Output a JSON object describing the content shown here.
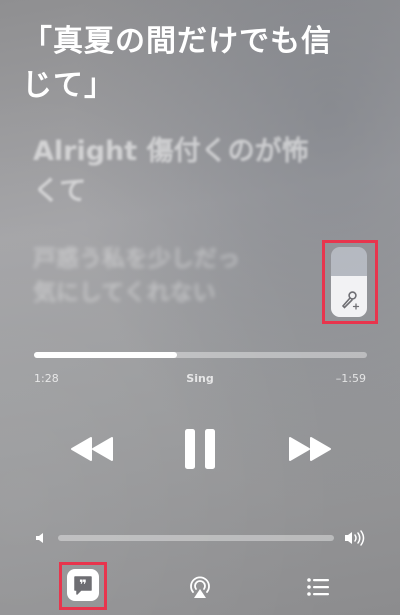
{
  "lyrics": {
    "current_line1": "「真夏の間だけでも信",
    "current_line2": "じて」",
    "next_line1": "Alright 傷付くのが怖",
    "next_line2": "くて",
    "far_line1": "戸惑う私を少しだっ",
    "far_line2": "気にしてくれない"
  },
  "sing_slider": {
    "level": 0.58,
    "icon": "microphone-plus-icon"
  },
  "playback": {
    "elapsed": "1:28",
    "mode": "Sing",
    "remaining": "–1:59",
    "progress": 0.43
  },
  "controls": {
    "rewind_icon": "rewind-icon",
    "pause_icon": "pause-icon",
    "forward_icon": "fast-forward-icon"
  },
  "volume": {
    "level": 0.0,
    "low_icon": "speaker-low-icon",
    "high_icon": "speaker-high-icon"
  },
  "bottom_bar": {
    "lyrics_icon": "lyrics-quote-icon",
    "airplay_icon": "airplay-icon",
    "queue_icon": "queue-list-icon"
  },
  "colors": {
    "highlight": "#e8354d",
    "text": "#ffffff"
  }
}
